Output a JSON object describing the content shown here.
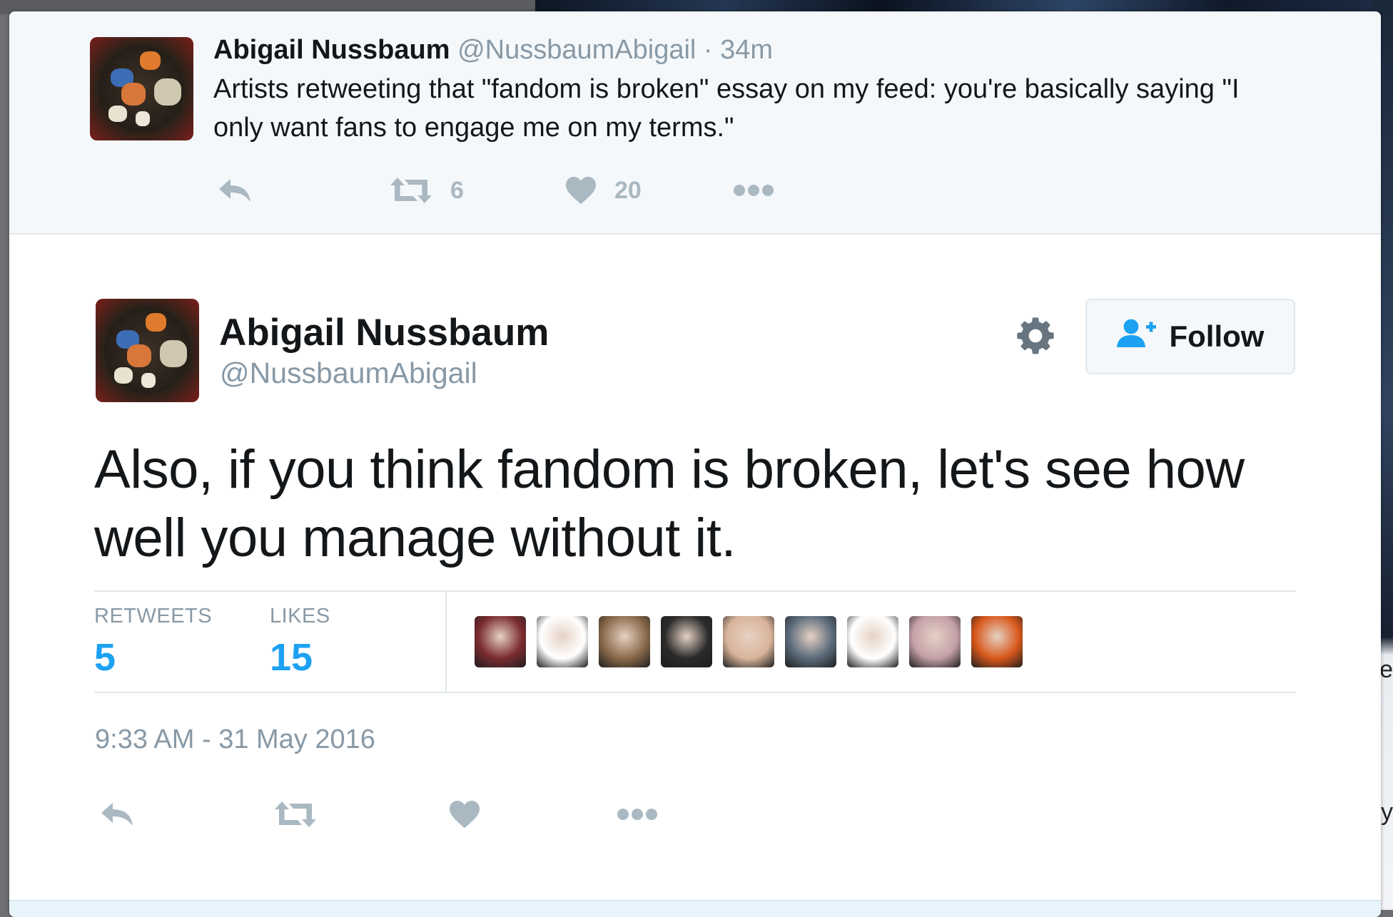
{
  "parent_tweet": {
    "name": "Abigail Nussbaum",
    "handle": "@NussbaumAbigail",
    "separator": "·",
    "time": "34m",
    "text": "Artists retweeting that \"fandom is broken\" essay on my feed: you're basically saying \"I only want fans to engage me on my terms.\"",
    "retweet_count": "6",
    "like_count": "20"
  },
  "main_tweet": {
    "name": "Abigail Nussbaum",
    "handle": "@NussbaumAbigail",
    "follow_label": "Follow",
    "text": "Also, if you think fandom is broken, let's see how well you manage without it.",
    "stats": {
      "retweets_label": "RETWEETS",
      "retweets_value": "5",
      "likes_label": "LIKES",
      "likes_value": "15"
    },
    "likers": [
      {
        "name": "liker-1",
        "color": "#7a2b2f"
      },
      {
        "name": "liker-2",
        "color": "#ffffff"
      },
      {
        "name": "liker-3",
        "color": "#8a6a4a"
      },
      {
        "name": "liker-4",
        "color": "#2a2a2a"
      },
      {
        "name": "liker-5",
        "color": "#d8b49a"
      },
      {
        "name": "liker-6",
        "color": "#5a6a7a"
      },
      {
        "name": "liker-7",
        "color": "#ffffff"
      },
      {
        "name": "liker-8",
        "color": "#c4a0a8"
      },
      {
        "name": "liker-9",
        "color": "#d8581c"
      }
    ],
    "timestamp": "9:33 AM - 31 May 2016"
  },
  "icons": {
    "reply": "reply-icon",
    "retweet": "retweet-icon",
    "like": "heart-icon",
    "more": "more-icon",
    "gear": "gear-icon",
    "follow": "add-user-icon"
  },
  "colors": {
    "accent": "#1da1f2",
    "muted": "#8899a6",
    "action_gray": "#aab8c2",
    "parent_bg": "#f5f8fa"
  },
  "background_peek": {
    "text_1": "e",
    "text_2": "y"
  }
}
